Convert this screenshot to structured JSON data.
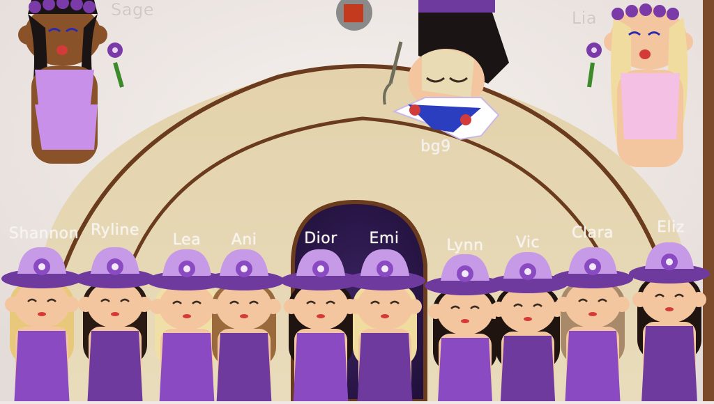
{
  "artwork": {
    "palette": {
      "wall": "#e9e2df",
      "dome": "#e6d7b4",
      "outline": "#6b3b1e",
      "frame": "#7a4a2a",
      "door": "#2a1648",
      "purple": "#6f3a9e",
      "lilac": "#c79ae8",
      "skin_light": "#f3c6a0",
      "skin_dark": "#8a5228"
    },
    "top_characters": [
      {
        "name": "Sage",
        "skin": "dark",
        "icon": "flower-icon"
      },
      {
        "name": "Lia",
        "skin": "light",
        "icon": "flower-icon"
      },
      {
        "name": "bg9",
        "pose": "upside-down"
      }
    ],
    "group": [
      {
        "name": "Shannon",
        "hair": "#e8c87a"
      },
      {
        "name": "Ryline",
        "hair": "#2a1a14"
      },
      {
        "name": "Lea",
        "hair": "#f1dfa8"
      },
      {
        "name": "Ani",
        "hair": "#9a6a3c"
      },
      {
        "name": "Dior",
        "hair": "#1f1410"
      },
      {
        "name": "Emi",
        "hair": "#f1dca0"
      },
      {
        "name": "Lynn",
        "hair": "#1f1410"
      },
      {
        "name": "Vic",
        "hair": "#1f1410"
      },
      {
        "name": "Clara",
        "hair": "#a88a6a"
      },
      {
        "name": "Eliz",
        "hair": "#1f1410"
      }
    ]
  }
}
